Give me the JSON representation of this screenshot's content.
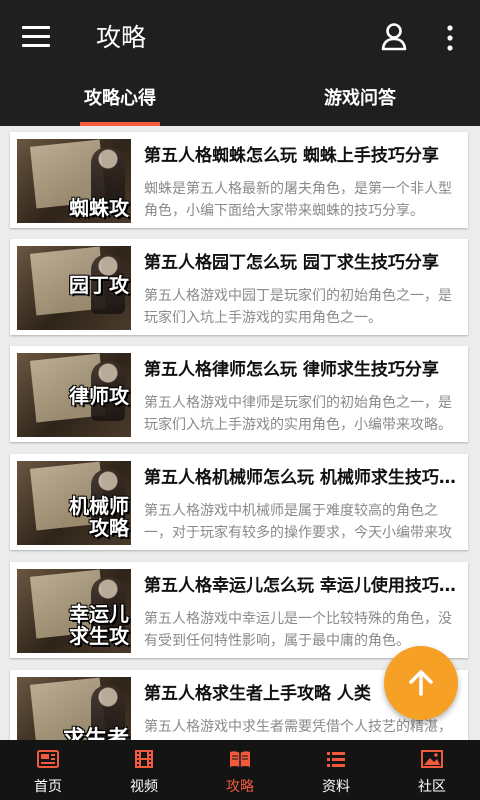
{
  "header": {
    "title": "攻略",
    "menu_icon": "hamburger-menu-icon",
    "user_icon": "user-icon",
    "more_icon": "more-vertical-icon"
  },
  "tabs": [
    {
      "label": "攻略心得",
      "active": true
    },
    {
      "label": "游戏问答",
      "active": false
    }
  ],
  "articles": [
    {
      "title": "第五人格蜘蛛怎么玩 蜘蛛上手技巧分享",
      "desc": "蜘蛛是第五人格最新的屠夫角色，是第一个非人型角色，小编下面给大家带来蜘蛛的技巧分享。",
      "thumb_caption": "蜘蛛攻"
    },
    {
      "title": "第五人格园丁怎么玩 园丁求生技巧分享",
      "desc": "第五人格游戏中园丁是玩家们的初始角色之一，是玩家们入坑上手游戏的实用角色之一。",
      "thumb_caption": "园丁攻"
    },
    {
      "title": "第五人格律师怎么玩 律师求生技巧分享",
      "desc": "第五人格游戏中律师是玩家们的初始角色之一，是玩家们入坑上手游戏的实用角色，小编带来攻略。",
      "thumb_caption": "律师攻"
    },
    {
      "title": "第五人格机械师怎么玩 机械师求生技巧分享",
      "desc": "第五人格游戏中机械师是属于难度较高的角色之一，对于玩家有较多的操作要求，今天小编带来攻略。",
      "thumb_caption": "机械师\n攻略"
    },
    {
      "title": "第五人格幸运儿怎么玩 幸运儿使用技巧分享",
      "desc": "第五人格游戏中幸运儿是一个比较特殊的角色，没有受到任何特性影响，属于最中庸的角色。",
      "thumb_caption": "幸运儿\n求生攻"
    },
    {
      "title": "第五人格求生者上手攻略 人类",
      "desc": "第五人格游戏中求生者需要凭借个人技艺的精湛，以及团队配合能力来，才能逃离庄园。",
      "thumb_caption": "求生者\n攻略"
    }
  ],
  "fab": {
    "icon": "arrow-up-icon"
  },
  "bottom_nav": [
    {
      "label": "首页",
      "icon": "home-icon",
      "active": false
    },
    {
      "label": "视频",
      "icon": "film-icon",
      "active": false
    },
    {
      "label": "攻略",
      "icon": "book-icon",
      "active": true
    },
    {
      "label": "资料",
      "icon": "list-icon",
      "active": false
    },
    {
      "label": "社区",
      "icon": "image-icon",
      "active": false
    }
  ],
  "colors": {
    "accent": "#f25a3c",
    "fab": "#f6a125",
    "bar": "#1f1f1f"
  }
}
